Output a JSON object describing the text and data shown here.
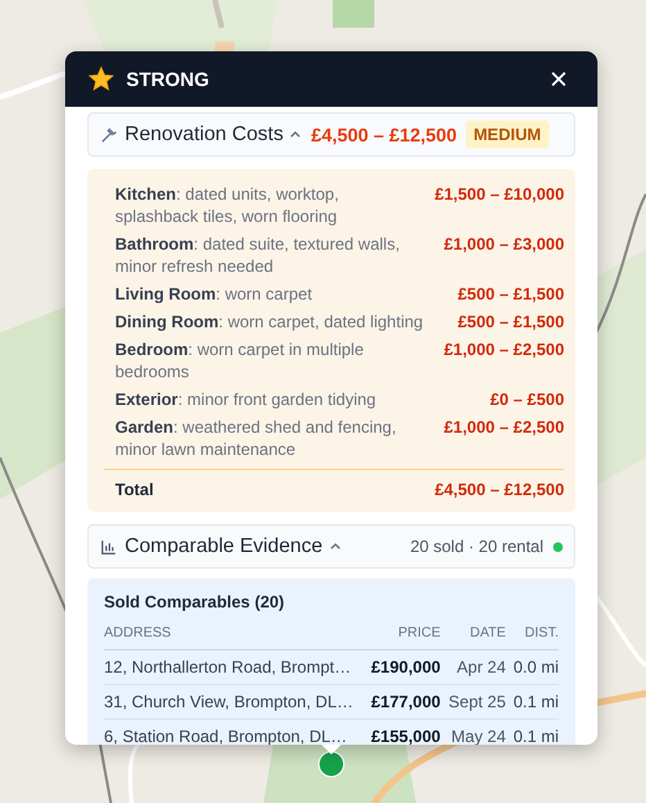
{
  "popup": {
    "title": "STRONG",
    "renovation": {
      "title": "Renovation Costs",
      "expanded": true,
      "total": "£4,500 – £12,500",
      "badge": "MEDIUM",
      "items": [
        {
          "text": "**Kitchen**: dated units, worktop, splashback tiles, worn flooring",
          "cost": "£1,500 – £10,000"
        },
        {
          "text": "**Bathroom**: dated suite, textured walls, minor refresh needed",
          "cost": "£1,000 – £3,000"
        },
        {
          "text": "**Living Room**: worn carpet",
          "cost": "£500 – £1,500"
        },
        {
          "text": "**Dining Room**: worn carpet, dated lighting",
          "cost": "£500 – £1,500"
        },
        {
          "text": "**Bedroom**: worn carpet in multiple bedrooms",
          "cost": "£1,000 – £2,500"
        },
        {
          "text": "**Exterior**: minor front garden tidying",
          "cost": "£0 – £500"
        },
        {
          "text": "**Garden**: weathered shed and fencing, minor lawn maintenance",
          "cost": "£1,000 – £2,500"
        }
      ],
      "total_label": "Total",
      "total_value": "£4,500 – £12,500"
    },
    "comparables": {
      "title": "Comparable Evidence",
      "expanded": true,
      "summary": "20 sold · 20 rental",
      "color": "#22c55e",
      "sold": {
        "title": "Sold Comparables (20)",
        "columns": [
          "ADDRESS",
          "PRICE",
          "DATE",
          "DIST."
        ],
        "rows": [
          [
            "12, Northallerton Road, Brompt…",
            "£190,000",
            "Apr 24",
            "0.0 mi"
          ],
          [
            "31, Church View, Brompton, DL…",
            "£177,000",
            "Sept 25",
            "0.1 mi"
          ],
          [
            "6, Station Road, Brompton, DL…",
            "£155,000",
            "May 24",
            "0.1 mi"
          ]
        ]
      }
    }
  }
}
